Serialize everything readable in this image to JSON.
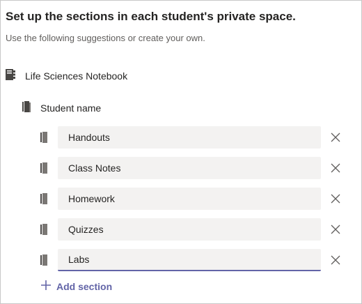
{
  "header": {
    "title": "Set up the sections in each student's private space.",
    "subtitle": "Use the following suggestions or create your own."
  },
  "notebook": {
    "name": "Life Sciences Notebook",
    "icon": "notebook-icon"
  },
  "student": {
    "label": "Student name",
    "icon": "section-group-icon"
  },
  "sections": [
    {
      "value": "Handouts",
      "icon": "section-icon",
      "remove_icon": "close-icon"
    },
    {
      "value": "Class Notes",
      "icon": "section-icon",
      "remove_icon": "close-icon"
    },
    {
      "value": "Homework",
      "icon": "section-icon",
      "remove_icon": "close-icon"
    },
    {
      "value": "Quizzes",
      "icon": "section-icon",
      "remove_icon": "close-icon"
    },
    {
      "value": "Labs",
      "icon": "section-icon",
      "remove_icon": "close-icon"
    }
  ],
  "add_section": {
    "label": "Add section",
    "icon": "plus-icon"
  },
  "colors": {
    "accent": "#6264a7",
    "input_background": "#f3f2f1",
    "text": "#252423",
    "muted_text": "#605e5c"
  }
}
